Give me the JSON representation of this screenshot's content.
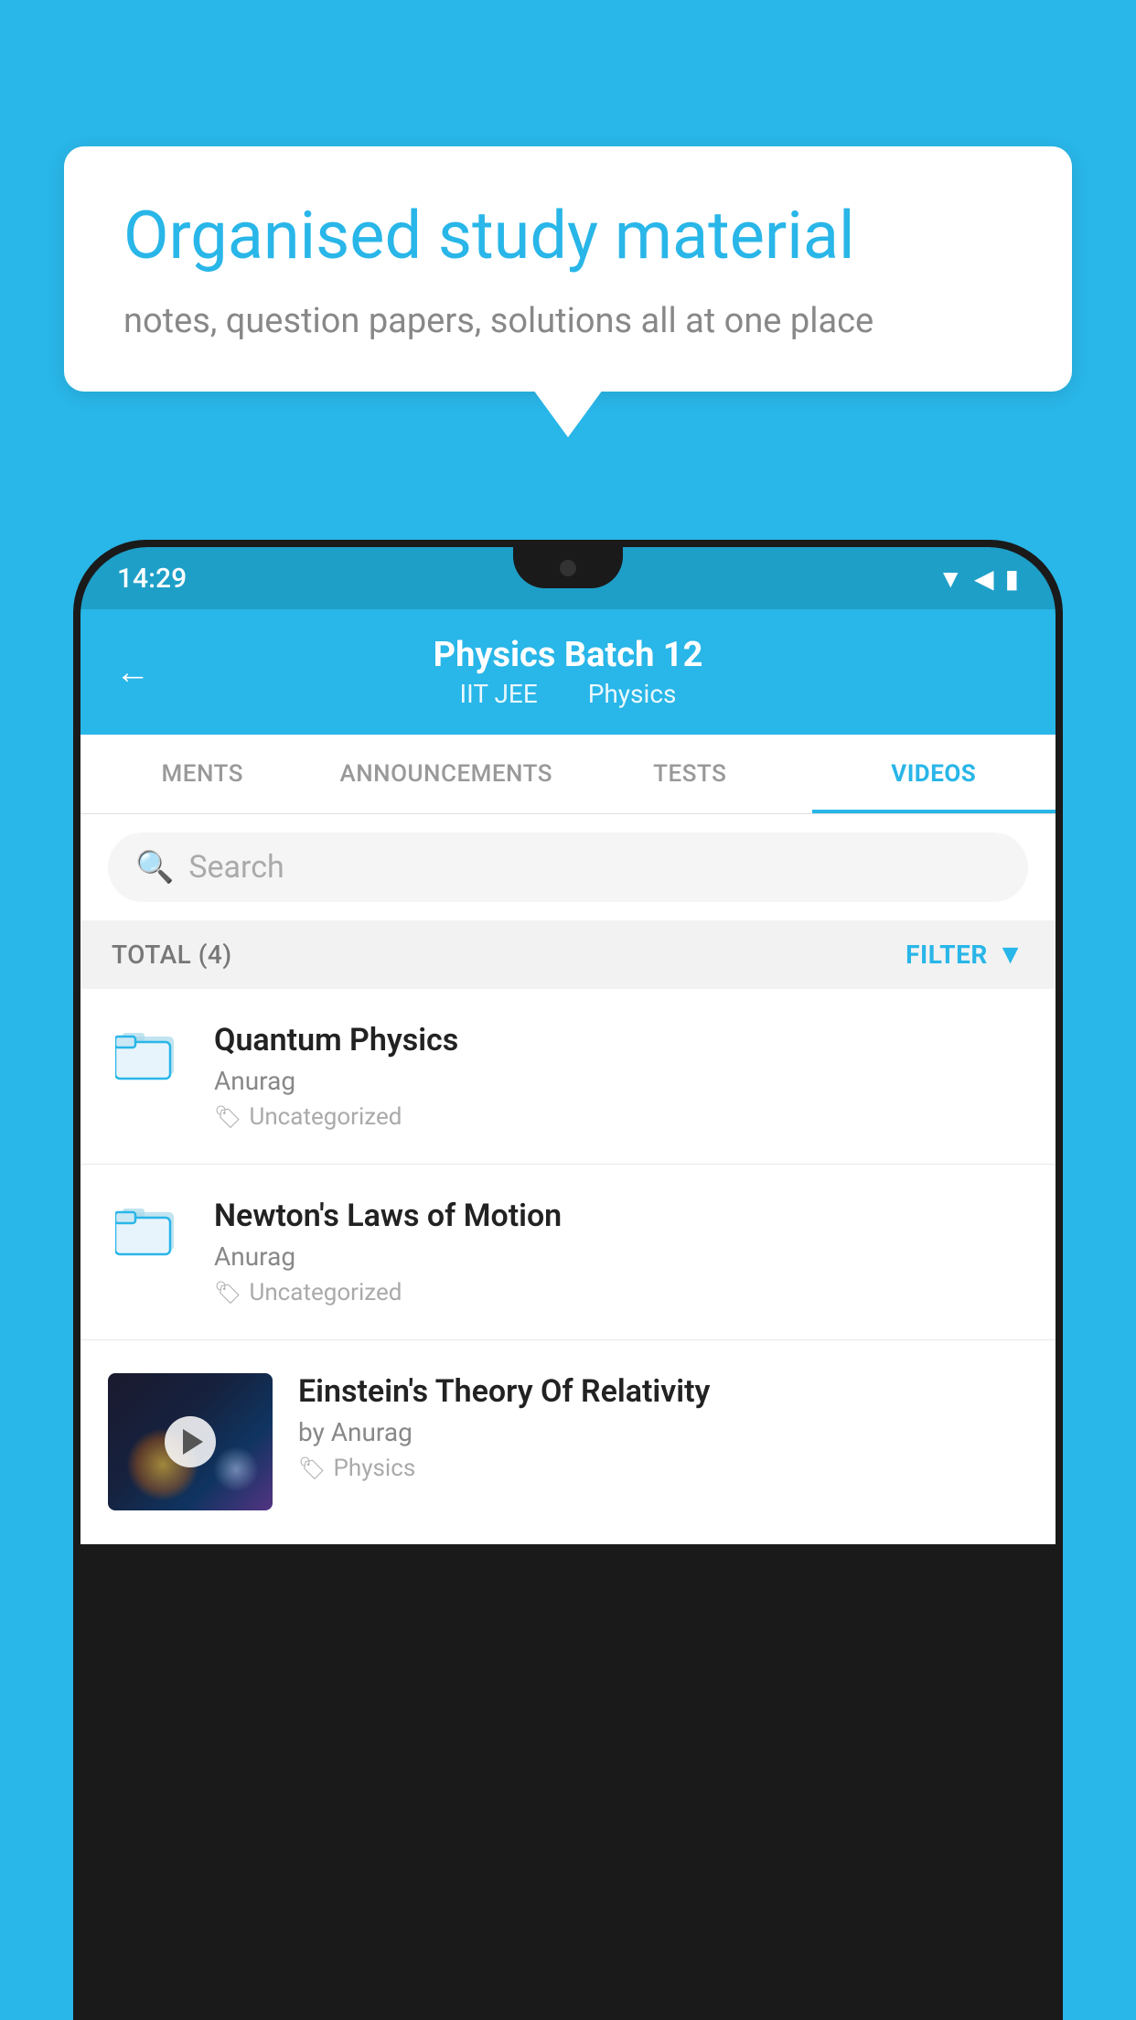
{
  "background_color": "#29b6e8",
  "bubble": {
    "title": "Organised study material",
    "subtitle": "notes, question papers, solutions all at one place"
  },
  "phone": {
    "status_bar": {
      "time": "14:29"
    },
    "header": {
      "back_label": "←",
      "title": "Physics Batch 12",
      "subtitle_part1": "IIT JEE",
      "subtitle_part2": "Physics"
    },
    "tabs": [
      {
        "label": "MENTS",
        "active": false
      },
      {
        "label": "ANNOUNCEMENTS",
        "active": false
      },
      {
        "label": "TESTS",
        "active": false
      },
      {
        "label": "VIDEOS",
        "active": true
      }
    ],
    "search": {
      "placeholder": "Search"
    },
    "filter_bar": {
      "total_label": "TOTAL (4)",
      "filter_label": "FILTER"
    },
    "videos": [
      {
        "title": "Quantum Physics",
        "author": "Anurag",
        "tag": "Uncategorized",
        "has_thumbnail": false
      },
      {
        "title": "Newton's Laws of Motion",
        "author": "Anurag",
        "tag": "Uncategorized",
        "has_thumbnail": false
      },
      {
        "title": "Einstein's Theory Of Relativity",
        "author": "by Anurag",
        "tag": "Physics",
        "has_thumbnail": true
      }
    ]
  }
}
